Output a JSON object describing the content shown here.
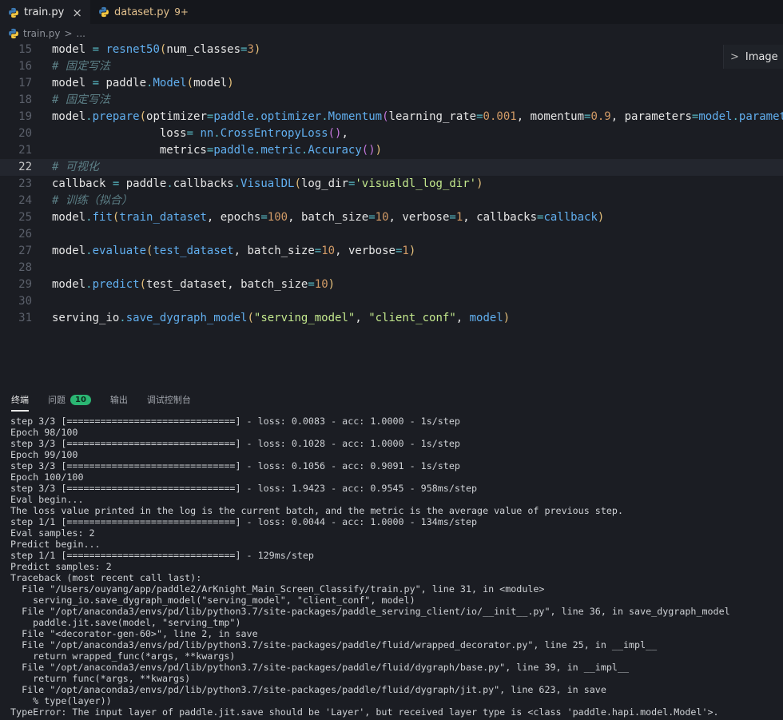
{
  "tabs": [
    {
      "name": "train.py",
      "close": "×"
    },
    {
      "name": "dataset.py",
      "badge": "9+"
    }
  ],
  "breadcrumb": {
    "file": "train.py",
    "sep": ">",
    "rest": "..."
  },
  "outline": {
    "chevron": ">",
    "label": "Image"
  },
  "editor": {
    "current_line": 22,
    "lines": [
      {
        "n": "15",
        "tokens": [
          [
            "model",
            "v"
          ],
          [
            " = ",
            "op"
          ],
          [
            "resnet50",
            "fn"
          ],
          [
            "(",
            "p1"
          ],
          [
            "num_classes",
            "v"
          ],
          [
            "=",
            "op"
          ],
          [
            "3",
            "num"
          ],
          [
            ")",
            "p1"
          ]
        ]
      },
      {
        "n": "16",
        "tokens": [
          [
            "# 固定写法",
            "cm"
          ]
        ]
      },
      {
        "n": "17",
        "tokens": [
          [
            "model",
            "v"
          ],
          [
            " = ",
            "op"
          ],
          [
            "paddle",
            "v"
          ],
          [
            ".",
            "op"
          ],
          [
            "Model",
            "fn"
          ],
          [
            "(",
            "p1"
          ],
          [
            "model",
            "v"
          ],
          [
            ")",
            "p1"
          ]
        ]
      },
      {
        "n": "18",
        "tokens": [
          [
            "# 固定写法",
            "cm"
          ]
        ]
      },
      {
        "n": "19",
        "tokens": [
          [
            "model",
            "v"
          ],
          [
            ".",
            "op"
          ],
          [
            "prepare",
            "fn"
          ],
          [
            "(",
            "p1"
          ],
          [
            "optimizer",
            "v"
          ],
          [
            "=",
            "op"
          ],
          [
            "paddle",
            "fn"
          ],
          [
            ".",
            "op"
          ],
          [
            "optimizer",
            "fn"
          ],
          [
            ".",
            "op"
          ],
          [
            "Momentum",
            "fn"
          ],
          [
            "(",
            "p2"
          ],
          [
            "learning_rate",
            "v"
          ],
          [
            "=",
            "op"
          ],
          [
            "0.001",
            "num"
          ],
          [
            ", ",
            "v"
          ],
          [
            "momentum",
            "v"
          ],
          [
            "=",
            "op"
          ],
          [
            "0.9",
            "num"
          ],
          [
            ", ",
            "v"
          ],
          [
            "parameters",
            "v"
          ],
          [
            "=",
            "op"
          ],
          [
            "model",
            "fn"
          ],
          [
            ".",
            "op"
          ],
          [
            "paramet",
            "fn"
          ]
        ]
      },
      {
        "n": "20",
        "tokens": [
          [
            "                loss",
            "v"
          ],
          [
            "= ",
            "op"
          ],
          [
            "nn",
            "fn"
          ],
          [
            ".",
            "op"
          ],
          [
            "CrossEntropyLoss",
            "fn"
          ],
          [
            "()",
            "p2"
          ],
          [
            ",",
            "v"
          ]
        ]
      },
      {
        "n": "21",
        "tokens": [
          [
            "                metrics",
            "v"
          ],
          [
            "=",
            "op"
          ],
          [
            "paddle",
            "fn"
          ],
          [
            ".",
            "op"
          ],
          [
            "metric",
            "fn"
          ],
          [
            ".",
            "op"
          ],
          [
            "Accuracy",
            "fn"
          ],
          [
            "()",
            "p2"
          ],
          [
            ")",
            "p1"
          ]
        ]
      },
      {
        "n": "22",
        "tokens": [
          [
            "# 可视化",
            "cm"
          ]
        ]
      },
      {
        "n": "23",
        "tokens": [
          [
            "callback",
            "v"
          ],
          [
            " = ",
            "op"
          ],
          [
            "paddle",
            "v"
          ],
          [
            ".",
            "op"
          ],
          [
            "callbacks",
            "v"
          ],
          [
            ".",
            "op"
          ],
          [
            "VisualDL",
            "fn"
          ],
          [
            "(",
            "p1"
          ],
          [
            "log_dir",
            "v"
          ],
          [
            "=",
            "op"
          ],
          [
            "'visualdl_log_dir'",
            "str"
          ],
          [
            ")",
            "p1"
          ]
        ]
      },
      {
        "n": "24",
        "tokens": [
          [
            "# 训练（拟合）",
            "cm"
          ]
        ]
      },
      {
        "n": "25",
        "tokens": [
          [
            "model",
            "v"
          ],
          [
            ".",
            "op"
          ],
          [
            "fit",
            "fn"
          ],
          [
            "(",
            "p1"
          ],
          [
            "train_dataset",
            "fn"
          ],
          [
            ", ",
            "v"
          ],
          [
            "epochs",
            "v"
          ],
          [
            "=",
            "op"
          ],
          [
            "100",
            "num"
          ],
          [
            ", ",
            "v"
          ],
          [
            "batch_size",
            "v"
          ],
          [
            "=",
            "op"
          ],
          [
            "10",
            "num"
          ],
          [
            ", ",
            "v"
          ],
          [
            "verbose",
            "v"
          ],
          [
            "=",
            "op"
          ],
          [
            "1",
            "num"
          ],
          [
            ", ",
            "v"
          ],
          [
            "callbacks",
            "v"
          ],
          [
            "=",
            "op"
          ],
          [
            "callback",
            "fn"
          ],
          [
            ")",
            "p1"
          ]
        ]
      },
      {
        "n": "26",
        "tokens": []
      },
      {
        "n": "27",
        "tokens": [
          [
            "model",
            "v"
          ],
          [
            ".",
            "op"
          ],
          [
            "evaluate",
            "fn"
          ],
          [
            "(",
            "p1"
          ],
          [
            "test_dataset",
            "fn"
          ],
          [
            ", ",
            "v"
          ],
          [
            "batch_size",
            "v"
          ],
          [
            "=",
            "op"
          ],
          [
            "10",
            "num"
          ],
          [
            ", ",
            "v"
          ],
          [
            "verbose",
            "v"
          ],
          [
            "=",
            "op"
          ],
          [
            "1",
            "num"
          ],
          [
            ")",
            "p1"
          ]
        ]
      },
      {
        "n": "28",
        "tokens": []
      },
      {
        "n": "29",
        "tokens": [
          [
            "model",
            "v"
          ],
          [
            ".",
            "op"
          ],
          [
            "predict",
            "fn"
          ],
          [
            "(",
            "p1"
          ],
          [
            "test_dataset",
            "v"
          ],
          [
            ", ",
            "v"
          ],
          [
            "batch_size",
            "v"
          ],
          [
            "=",
            "op"
          ],
          [
            "10",
            "num"
          ],
          [
            ")",
            "p1"
          ]
        ]
      },
      {
        "n": "30",
        "tokens": []
      },
      {
        "n": "31",
        "tokens": [
          [
            "serving_io",
            "v"
          ],
          [
            ".",
            "op"
          ],
          [
            "save_dygraph_model",
            "fn"
          ],
          [
            "(",
            "p1"
          ],
          [
            "\"serving_model\"",
            "str"
          ],
          [
            ", ",
            "v"
          ],
          [
            "\"client_conf\"",
            "str"
          ],
          [
            ", ",
            "v"
          ],
          [
            "model",
            "fn"
          ],
          [
            ")",
            "p1"
          ]
        ]
      }
    ]
  },
  "panel": {
    "tabs": [
      {
        "label": "终端",
        "active": true
      },
      {
        "label": "问题",
        "badge": "10"
      },
      {
        "label": "输出"
      },
      {
        "label": "调试控制台"
      }
    ]
  },
  "terminal": {
    "lines": [
      "step 3/3 [==============================] - loss: 0.0083 - acc: 1.0000 - 1s/step",
      "Epoch 98/100",
      "step 3/3 [==============================] - loss: 0.1028 - acc: 1.0000 - 1s/step",
      "Epoch 99/100",
      "step 3/3 [==============================] - loss: 0.1056 - acc: 0.9091 - 1s/step",
      "Epoch 100/100",
      "step 3/3 [==============================] - loss: 1.9423 - acc: 0.9545 - 958ms/step",
      "Eval begin...",
      "The loss value printed in the log is the current batch, and the metric is the average value of previous step.",
      "step 1/1 [==============================] - loss: 0.0044 - acc: 1.0000 - 134ms/step",
      "Eval samples: 2",
      "Predict begin...",
      "step 1/1 [==============================] - 129ms/step",
      "Predict samples: 2",
      "Traceback (most recent call last):",
      "  File \"/Users/ouyang/app/paddle2/ArKnight_Main_Screen_Classify/train.py\", line 31, in <module>",
      "    serving_io.save_dygraph_model(\"serving_model\", \"client_conf\", model)",
      "  File \"/opt/anaconda3/envs/pd/lib/python3.7/site-packages/paddle_serving_client/io/__init__.py\", line 36, in save_dygraph_model",
      "    paddle.jit.save(model, \"serving_tmp\")",
      "  File \"<decorator-gen-60>\", line 2, in save",
      "  File \"/opt/anaconda3/envs/pd/lib/python3.7/site-packages/paddle/fluid/wrapped_decorator.py\", line 25, in __impl__",
      "    return wrapped_func(*args, **kwargs)",
      "  File \"/opt/anaconda3/envs/pd/lib/python3.7/site-packages/paddle/fluid/dygraph/base.py\", line 39, in __impl__",
      "    return func(*args, **kwargs)",
      "  File \"/opt/anaconda3/envs/pd/lib/python3.7/site-packages/paddle/fluid/dygraph/jit.py\", line 623, in save",
      "    % type(layer))",
      "TypeError: The input layer of paddle.jit.save should be 'Layer', but received layer type is <class 'paddle.hapi.model.Model'>."
    ]
  },
  "colors": {
    "accent_badge": "#2bb673",
    "modified_file": "#e2c08d",
    "background": "#1b1d23"
  }
}
